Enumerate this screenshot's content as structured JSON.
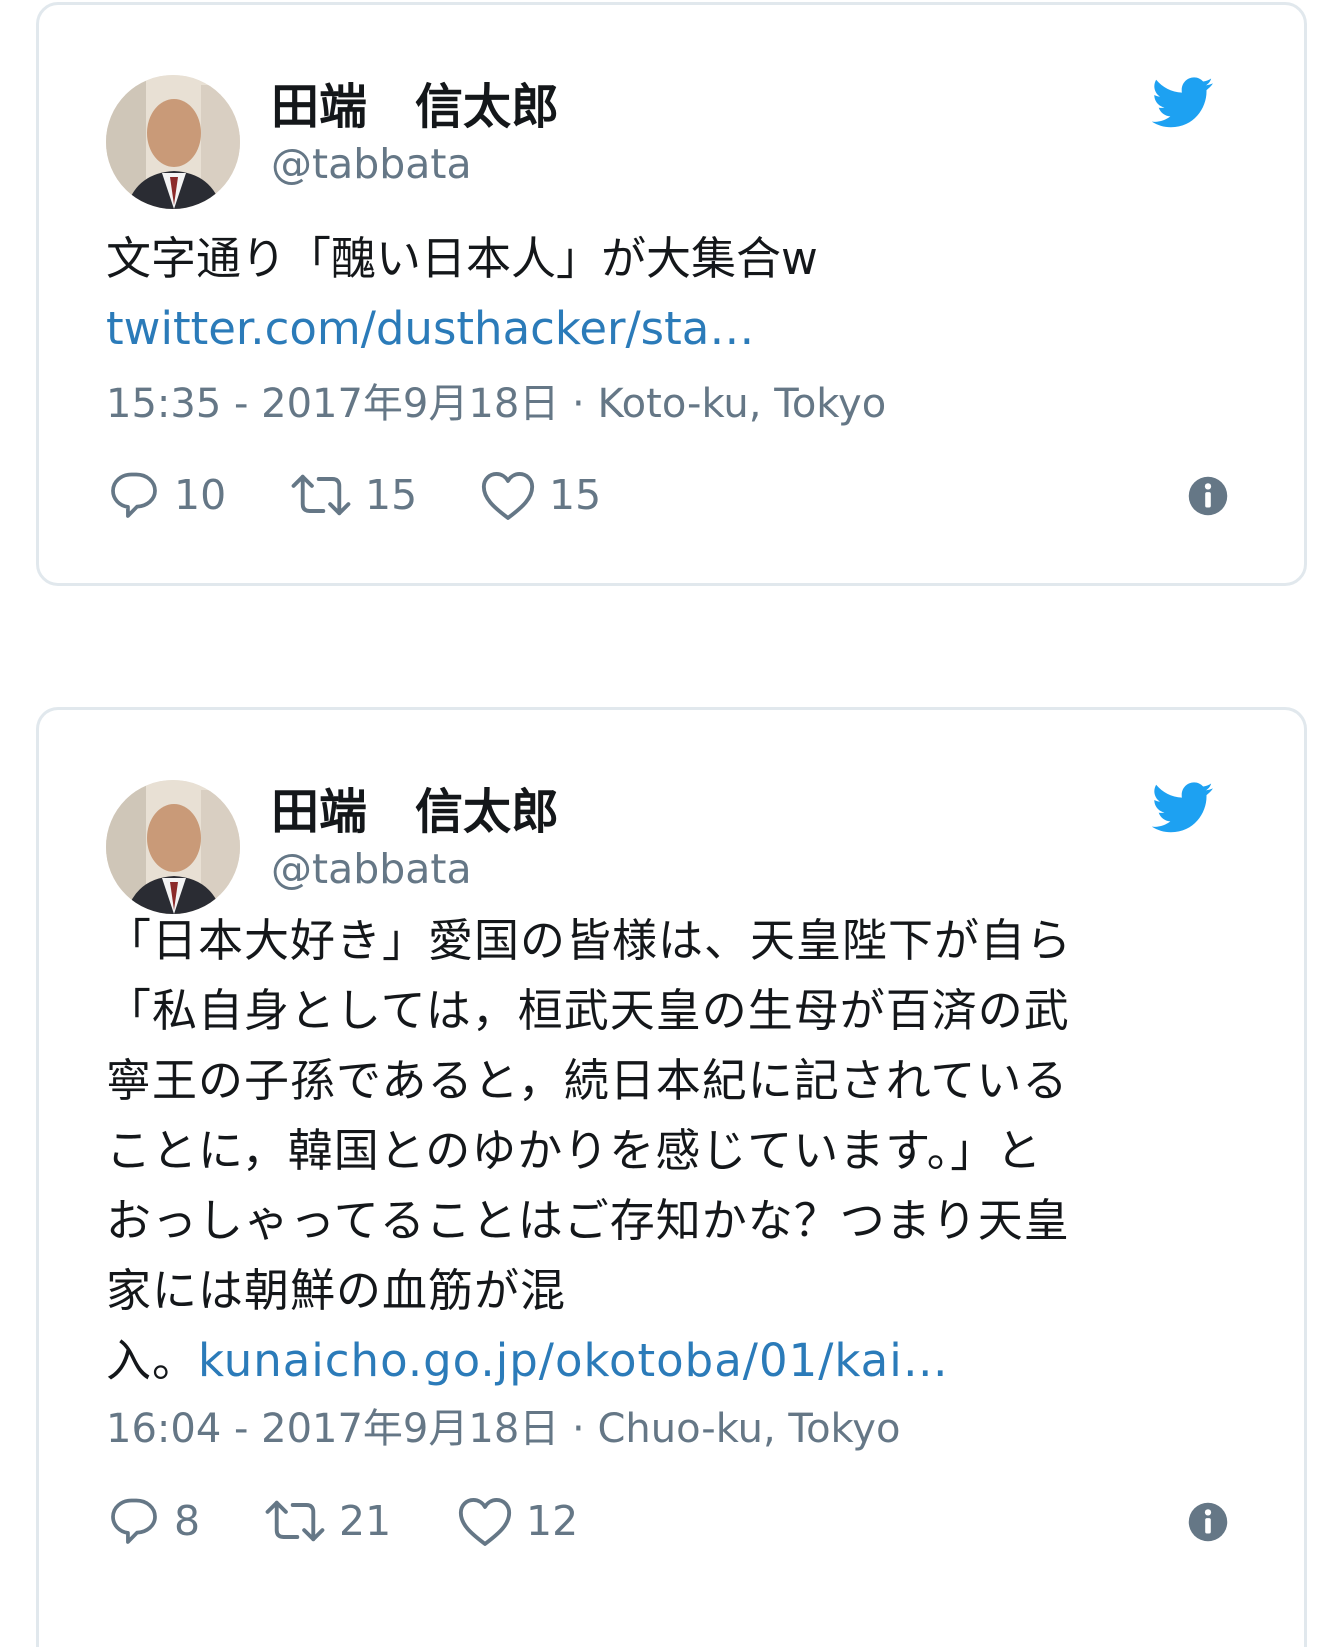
{
  "colors": {
    "link": "#2b7bb9",
    "twitter_blue": "#1da1f2",
    "secondary_text": "#657786",
    "border": "#e1e8ed"
  },
  "tweets": [
    {
      "author_name": "田端　信太郎",
      "author_handle": "@tabbata",
      "text_lines": [
        "文字通り「醜い日本人」が大集合w"
      ],
      "link": "twitter.com/dusthacker/sta…",
      "timestamp": "15:35 - 2017年9月18日",
      "location": "Koto-ku, Tokyo",
      "replies": "10",
      "retweets": "15",
      "likes": "15",
      "icons": [
        "avatar",
        "twitter-bird-icon",
        "reply-icon",
        "retweet-icon",
        "heart-icon",
        "info-icon"
      ]
    },
    {
      "author_name": "田端　信太郎",
      "author_handle": "@tabbata",
      "text_lines": [
        "「日本大好き」愛国の皆様は、天皇陛下が自ら",
        "「私自身としては，桓武天皇の生母が百済の武",
        "寧王の子孫であると，続日本紀に記されている",
        "ことに，韓国とのゆかりを感じています。」と",
        "おっしゃってることはご存知かな？つまり天皇",
        "家には朝鮮の血筋が混"
      ],
      "text_tail": "入。",
      "link": "kunaicho.go.jp/okotoba/01/kai…",
      "timestamp": "16:04 - 2017年9月18日",
      "location": "Chuo-ku, Tokyo",
      "replies": "8",
      "retweets": "21",
      "likes": "12",
      "icons": [
        "avatar",
        "twitter-bird-icon",
        "reply-icon",
        "retweet-icon",
        "heart-icon",
        "info-icon"
      ]
    }
  ],
  "separator": " · "
}
